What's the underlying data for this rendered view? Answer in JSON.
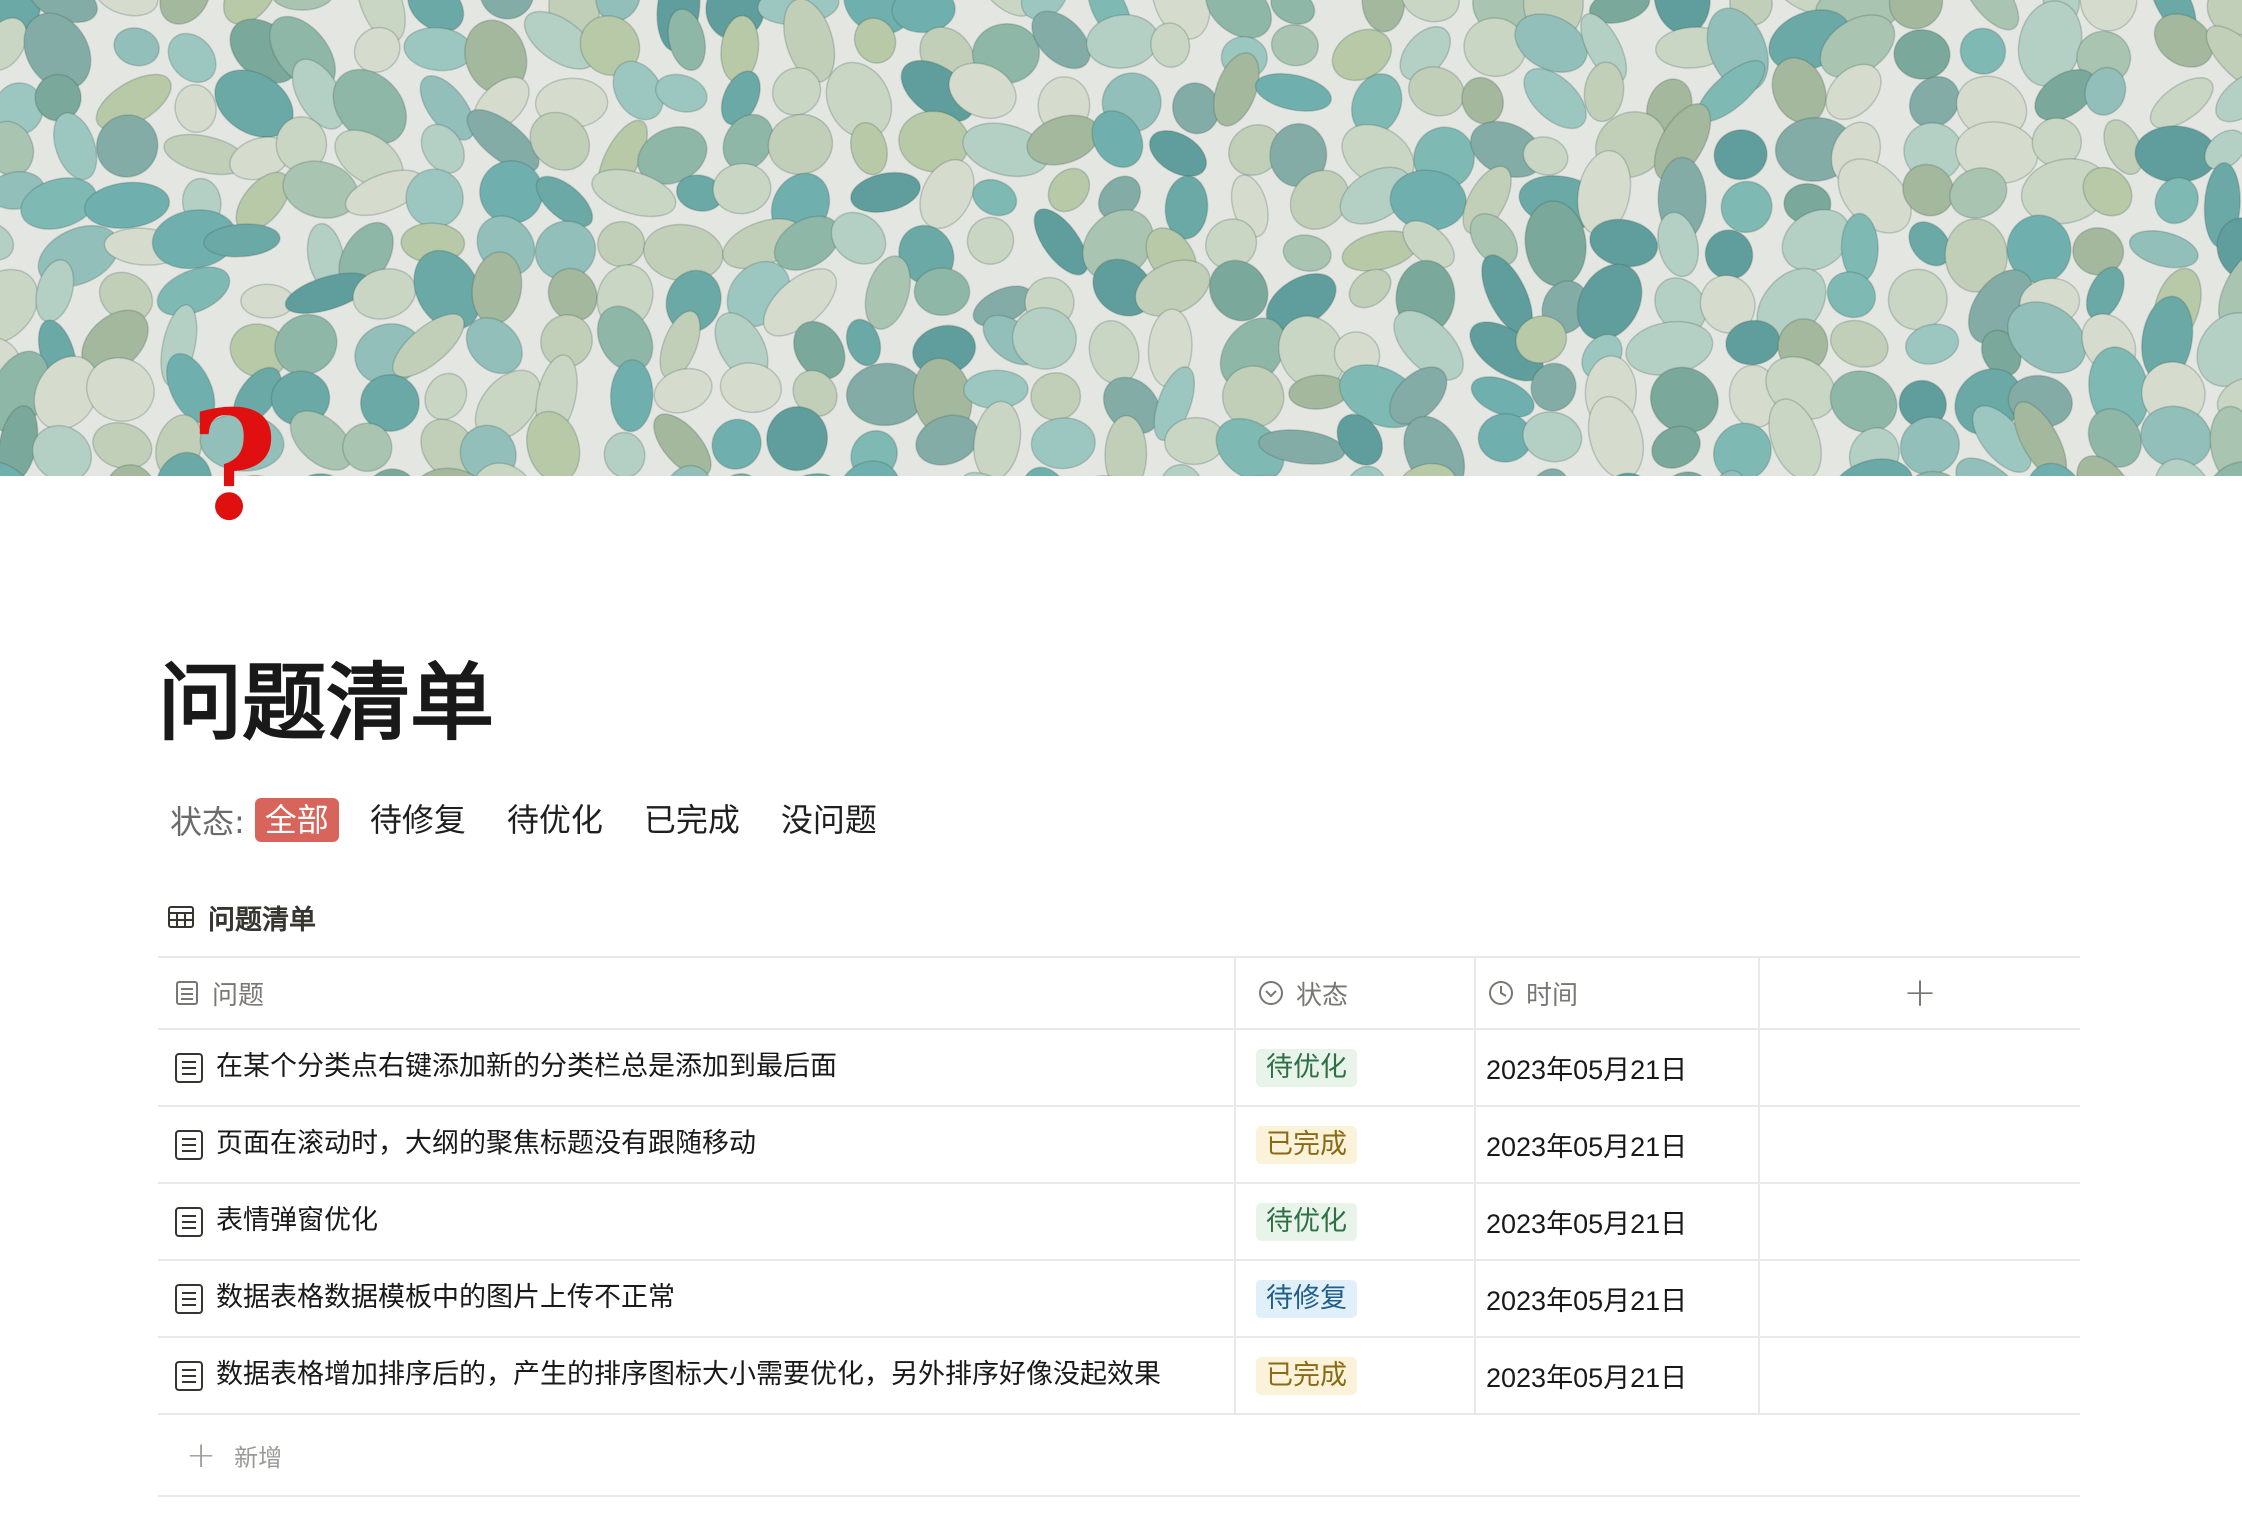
{
  "page": {
    "title": "问题清单",
    "icon": "question-mark-icon",
    "cover": "river-pebbles-cover"
  },
  "filter": {
    "label": "状态:",
    "options": [
      "全部",
      "待修复",
      "待优化",
      "已完成",
      "没问题"
    ],
    "active": "全部",
    "active_color": "#d8655b"
  },
  "database": {
    "title": "问题清单",
    "title_icon": "table-icon",
    "columns": [
      {
        "label": "问题",
        "icon": "text-lines-icon"
      },
      {
        "label": "状态",
        "icon": "status-circle-icon"
      },
      {
        "label": "时间",
        "icon": "clock-icon"
      },
      {
        "label": "+",
        "icon": "add-column-icon"
      }
    ],
    "rows": [
      {
        "issue": "在某个分类点右键添加新的分类栏总是添加到最后面",
        "status": "待优化",
        "date": "2023年05月21日"
      },
      {
        "issue": "页面在滚动时，大纲的聚焦标题没有跟随移动",
        "status": "已完成",
        "date": "2023年05月21日"
      },
      {
        "issue": "表情弹窗优化",
        "status": "待优化",
        "date": "2023年05月21日"
      },
      {
        "issue": "数据表格数据模板中的图片上传不正常",
        "status": "待修复",
        "date": "2023年05月21日"
      },
      {
        "issue": "数据表格增加排序后的，产生的排序图标大小需要优化，另外排序好像没起效果",
        "status": "已完成",
        "date": "2023年05月21日"
      }
    ],
    "new_label": "新增",
    "status_colors": {
      "待优化": "#e8f4ea",
      "已完成": "#fbf3d9",
      "待修复": "#e1eff9"
    }
  }
}
